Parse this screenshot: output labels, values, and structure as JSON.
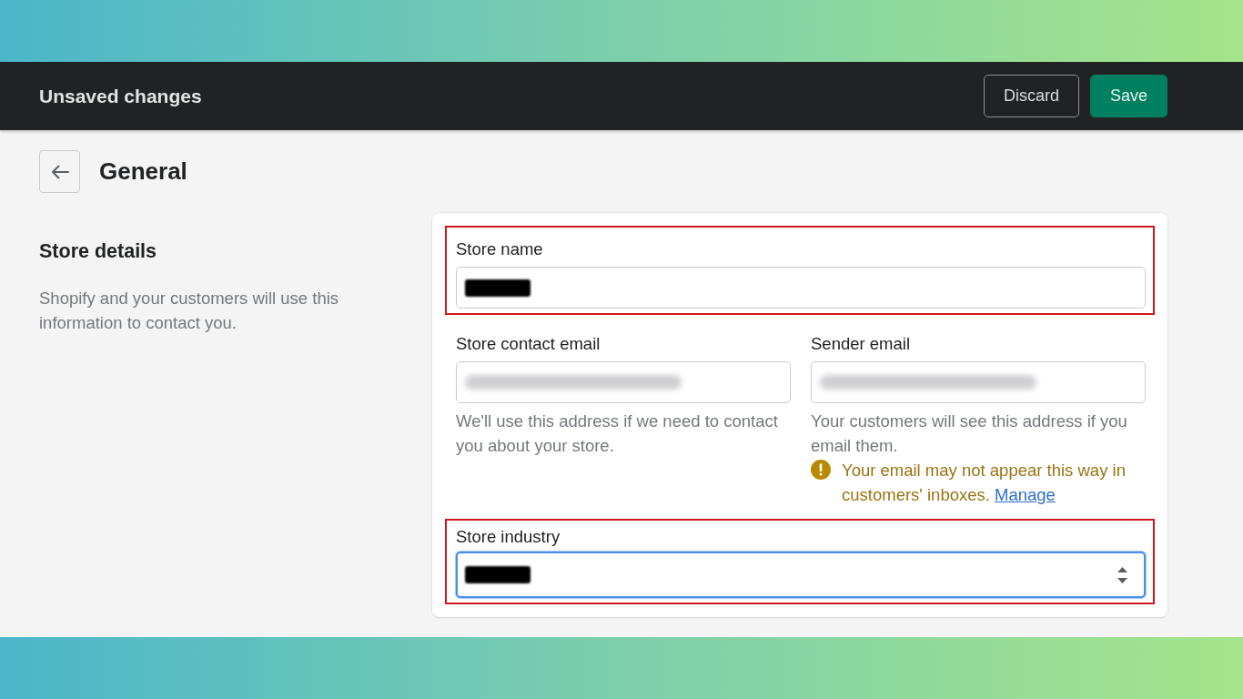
{
  "banner": {
    "title": "Unsaved changes",
    "buttons": [
      {
        "label": "Discard",
        "kind": "secondary"
      },
      {
        "label": "Save",
        "kind": "primary"
      }
    ]
  },
  "page": {
    "title": "General"
  },
  "section": {
    "title": "Store details",
    "description": "Shopify and your customers will use this information to contact you."
  },
  "form": {
    "rows": [
      {
        "fields": [
          {
            "label": "Store name",
            "kind": "text",
            "value": {
              "kind": "redacted"
            },
            "highlighted": true,
            "focused": false
          }
        ]
      },
      {
        "fields": [
          {
            "label": "Store contact email",
            "kind": "text",
            "value": {
              "kind": "blurred"
            },
            "highlighted": false,
            "focused": false,
            "help": "We'll use this address if we need to contact you about your store."
          },
          {
            "label": "Sender email",
            "kind": "text",
            "value": {
              "kind": "blurred"
            },
            "highlighted": false,
            "focused": false,
            "help": "Your customers will see this address if you email them.",
            "warning": {
              "text": "Your email may not appear this way in customers' inboxes.",
              "link": "Manage"
            }
          }
        ]
      },
      {
        "fields": [
          {
            "label": "Store industry",
            "kind": "select",
            "value": {
              "kind": "redacted"
            },
            "highlighted": true,
            "focused": true
          }
        ]
      }
    ]
  }
}
